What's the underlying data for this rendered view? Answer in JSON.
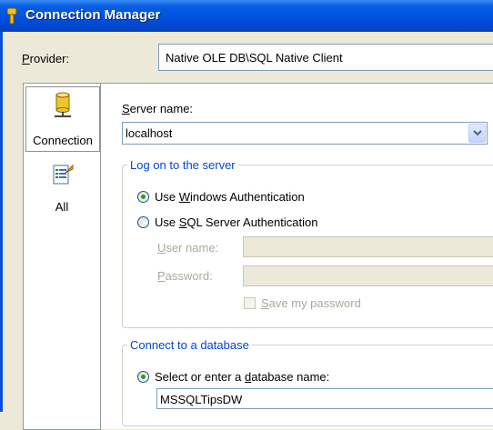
{
  "window": {
    "title": "Connection Manager"
  },
  "provider": {
    "label": "Provider:",
    "accesskey": "P",
    "value": "Native OLE DB\\SQL Native Client"
  },
  "sidebar": {
    "items": [
      {
        "label": "Connection",
        "icon": "database-cylinder-icon",
        "selected": true
      },
      {
        "label": "All",
        "icon": "properties-list-icon",
        "selected": false
      }
    ]
  },
  "server": {
    "label_before": "",
    "label_accesskey": "S",
    "label_after": "erver name:",
    "value": "localhost"
  },
  "logon": {
    "title": "Log on to the server",
    "windows_auth": {
      "before": "Use ",
      "key": "W",
      "after": "indows Authentication",
      "selected": true
    },
    "sql_auth": {
      "before": "Use ",
      "key": "S",
      "after": "QL Server Authentication",
      "selected": false
    },
    "username": {
      "key": "U",
      "after": "ser name:",
      "value": ""
    },
    "password": {
      "key": "P",
      "after": "assword:",
      "value": ""
    },
    "save_password": {
      "key": "S",
      "after": "ave my password",
      "checked": false
    }
  },
  "database": {
    "title": "Connect to a database",
    "select_option": {
      "before": "Select or enter a ",
      "key": "d",
      "after": "atabase name:",
      "selected": true
    },
    "value": "MSSQLTipsDW"
  },
  "colors": {
    "title_bar": "#0055e5",
    "group_title": "#0046d5",
    "face": "#ece9d8",
    "radio_dot": "#21a121"
  }
}
